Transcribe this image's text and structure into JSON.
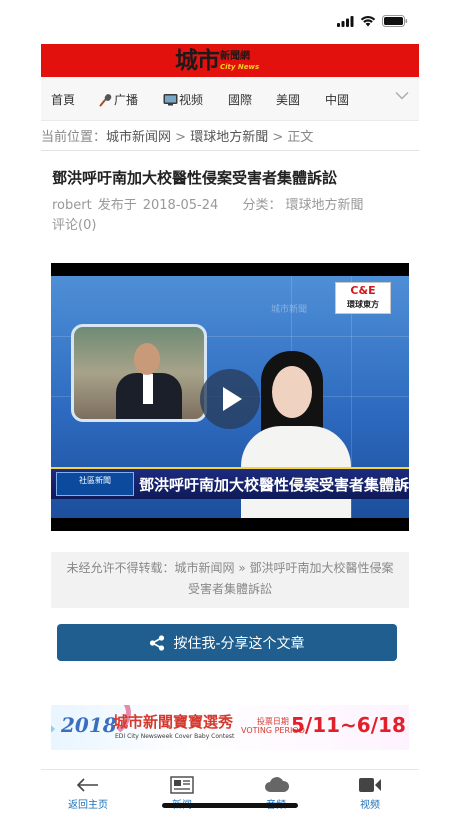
{
  "site": {
    "logo_main": "城市",
    "logo_cn": "新聞網",
    "logo_en": "City News"
  },
  "nav": {
    "items": [
      {
        "label": "首頁",
        "icon": ""
      },
      {
        "label": "广播",
        "icon": "microphone-icon"
      },
      {
        "label": "视频",
        "icon": "tv-icon"
      },
      {
        "label": "國際",
        "icon": ""
      },
      {
        "label": "美國",
        "icon": ""
      },
      {
        "label": "中國",
        "icon": ""
      }
    ]
  },
  "breadcrumb": {
    "prefix": "当前位置：",
    "home": "城市新闻网",
    "sep1": " > ",
    "section": "環球地方新聞",
    "sep2": " > ",
    "current": "正文"
  },
  "article": {
    "title": "鄧洪呼吁南加大校醫性侵案受害者集體訴訟",
    "author": "robert",
    "published_label": "发布于",
    "date": "2018-05-24",
    "category_label": "分类：",
    "category": "環球地方新聞",
    "comments": "评论(0)"
  },
  "video": {
    "headline": "鄧洪呼吁南加大校醫性侵案受害者集體訴訟",
    "channel_logo": "C&E",
    "channel_name": "環球東方",
    "badge_text": "社區新聞",
    "watermark": "城市新聞"
  },
  "copyright": {
    "prefix": "未经允许不得转载：",
    "site": "城市新闻网",
    "sep": " » ",
    "title": "鄧洪呼吁南加大校醫性侵案受害者集體訴訟"
  },
  "share": {
    "label": "按住我-分享这个文章"
  },
  "banner": {
    "year": "2018",
    "title": "城市新聞寶寶選秀",
    "subtitle": "EDI City Newsweek Cover Baby Contest",
    "vote_cn": "投票日期",
    "vote_en": "VOTING PERIOD",
    "dates": "5/11~6/18"
  },
  "tabbar": {
    "items": [
      {
        "label": "返回主页",
        "icon": "back-arrow-icon"
      },
      {
        "label": "新闻",
        "icon": "newspaper-icon"
      },
      {
        "label": "音频",
        "icon": "cloud-icon"
      },
      {
        "label": "视频",
        "icon": "video-camera-icon"
      }
    ]
  },
  "colors": {
    "header_red": "#e2110d",
    "accent_blue": "#1f5e8e",
    "tab_blue": "#1d6fb8"
  }
}
